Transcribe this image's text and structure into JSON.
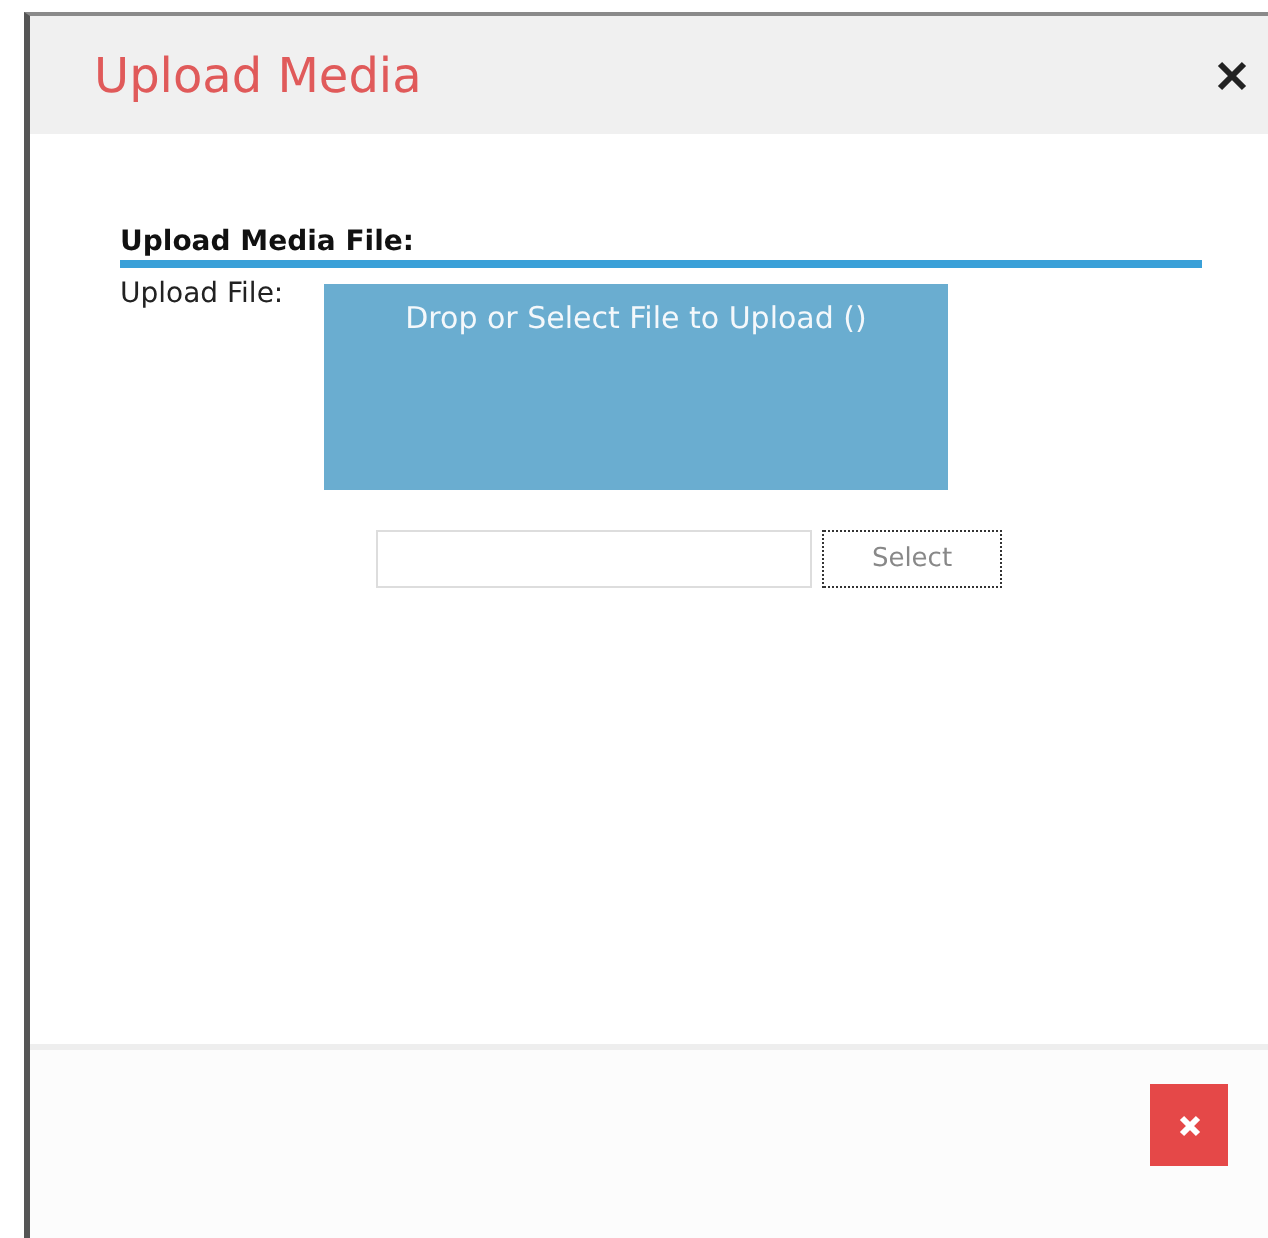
{
  "dialog": {
    "title": "Upload Media"
  },
  "section": {
    "title": "Upload Media File:"
  },
  "upload": {
    "label": "Upload File:",
    "dropzone_text": "Drop or Select File to Upload ()",
    "select_button": "Select"
  }
}
